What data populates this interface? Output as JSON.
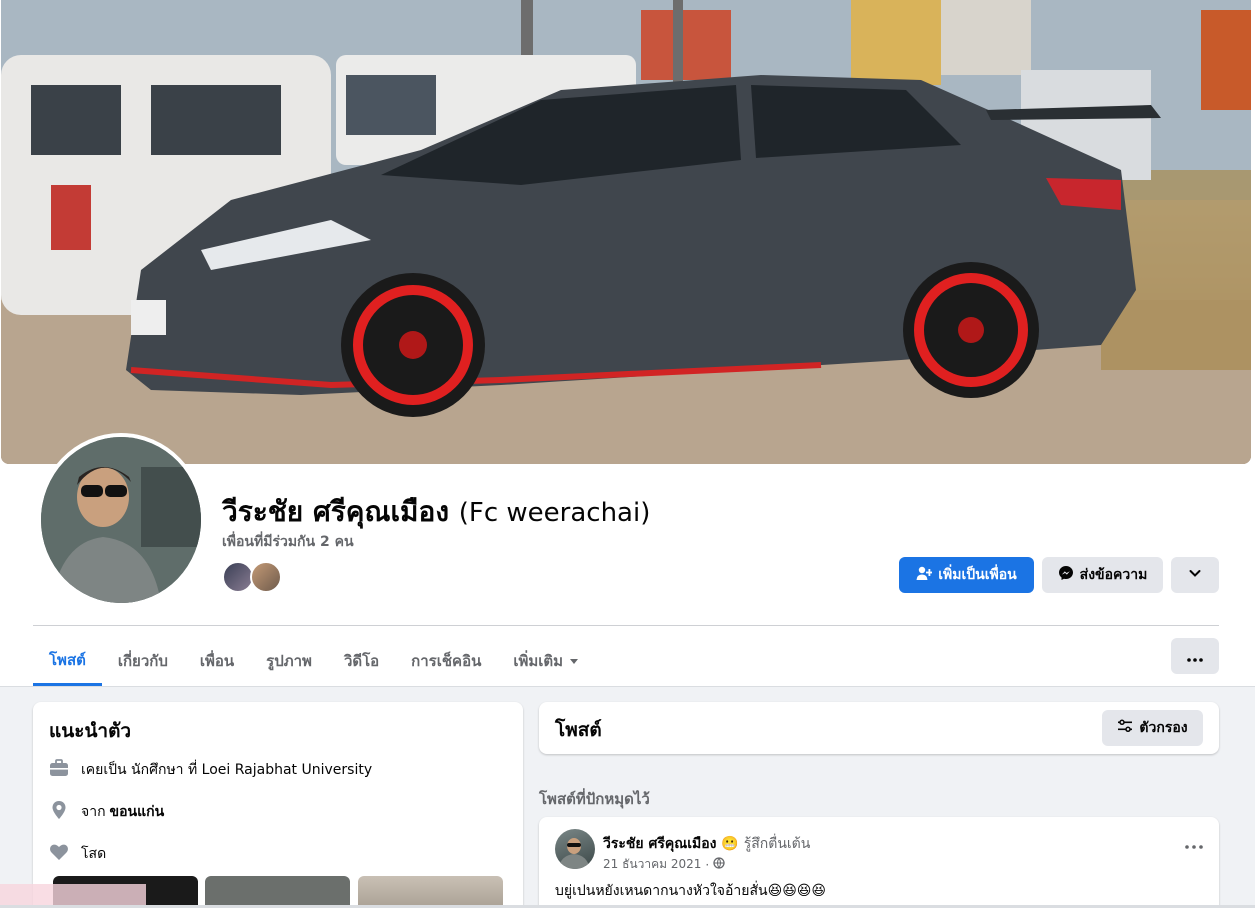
{
  "profile": {
    "name": "วีระชัย ศรีคุณเมือง",
    "alt_name": "(Fc weerachai)",
    "mutual_friends": "เพื่อนที่มีร่วมกัน 2 คน"
  },
  "actions": {
    "add_friend": "เพิ่มเป็นเพื่อน",
    "message": "ส่งข้อความ"
  },
  "tabs": [
    {
      "label": "โพสต์"
    },
    {
      "label": "เกี่ยวกับ"
    },
    {
      "label": "เพื่อน"
    },
    {
      "label": "รูปภาพ"
    },
    {
      "label": "วิดีโอ"
    },
    {
      "label": "การเช็คอิน"
    },
    {
      "label": "เพิ่มเติม"
    }
  ],
  "intro": {
    "title": "แนะนำตัว",
    "work_prefix": "เคยเป็น นักศึกษา ที่ Loei Rajabhat University",
    "from_prefix": "จาก",
    "from_place": "ขอนแก่น",
    "relationship": "โสด"
  },
  "posts": {
    "title": "โพสต์",
    "filter": "ตัวกรอง",
    "pinned_label": "โพสต์ที่ปักหมุดไว้",
    "pinned_post": {
      "author": "วีระชัย ศรีคุณเมือง",
      "feeling": "รู้สึกตื่นเต้น",
      "date": "21 ธันวาคม 2021",
      "text": "บยู่เปนหยังเหนดากนางหัวใจอ้ายสั่น😆😆😆😆"
    }
  },
  "colors": {
    "accent": "#1b74e4",
    "page_bg": "#f0f2f5",
    "secondary_text": "#65676b"
  }
}
